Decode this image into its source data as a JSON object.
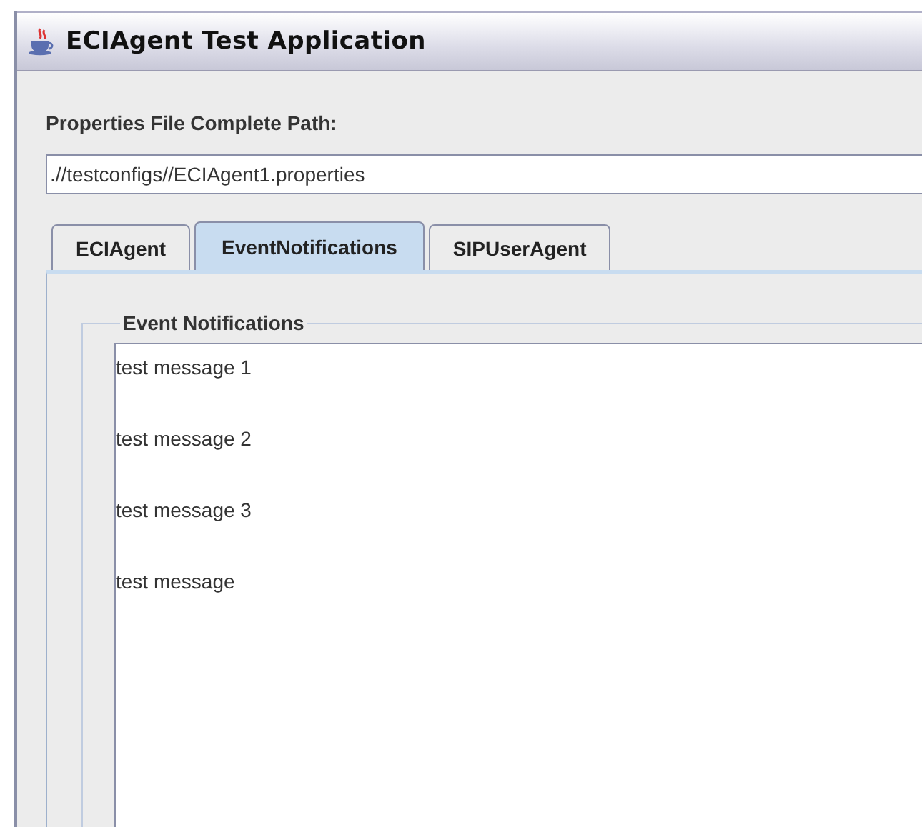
{
  "window": {
    "title": "ECIAgent Test Application"
  },
  "path_label": "Properties File Complete Path:",
  "path_field": {
    "value": ".//testconfigs//ECIAgent1.properties"
  },
  "tabs": [
    {
      "label": "ECIAgent",
      "selected": false
    },
    {
      "label": "EventNotifications",
      "selected": true
    },
    {
      "label": "SIPUserAgent",
      "selected": false
    }
  ],
  "group": {
    "title": "Event Notifications",
    "messages": [
      "test message 1",
      "test message 2",
      "test message 3",
      "test message"
    ]
  }
}
